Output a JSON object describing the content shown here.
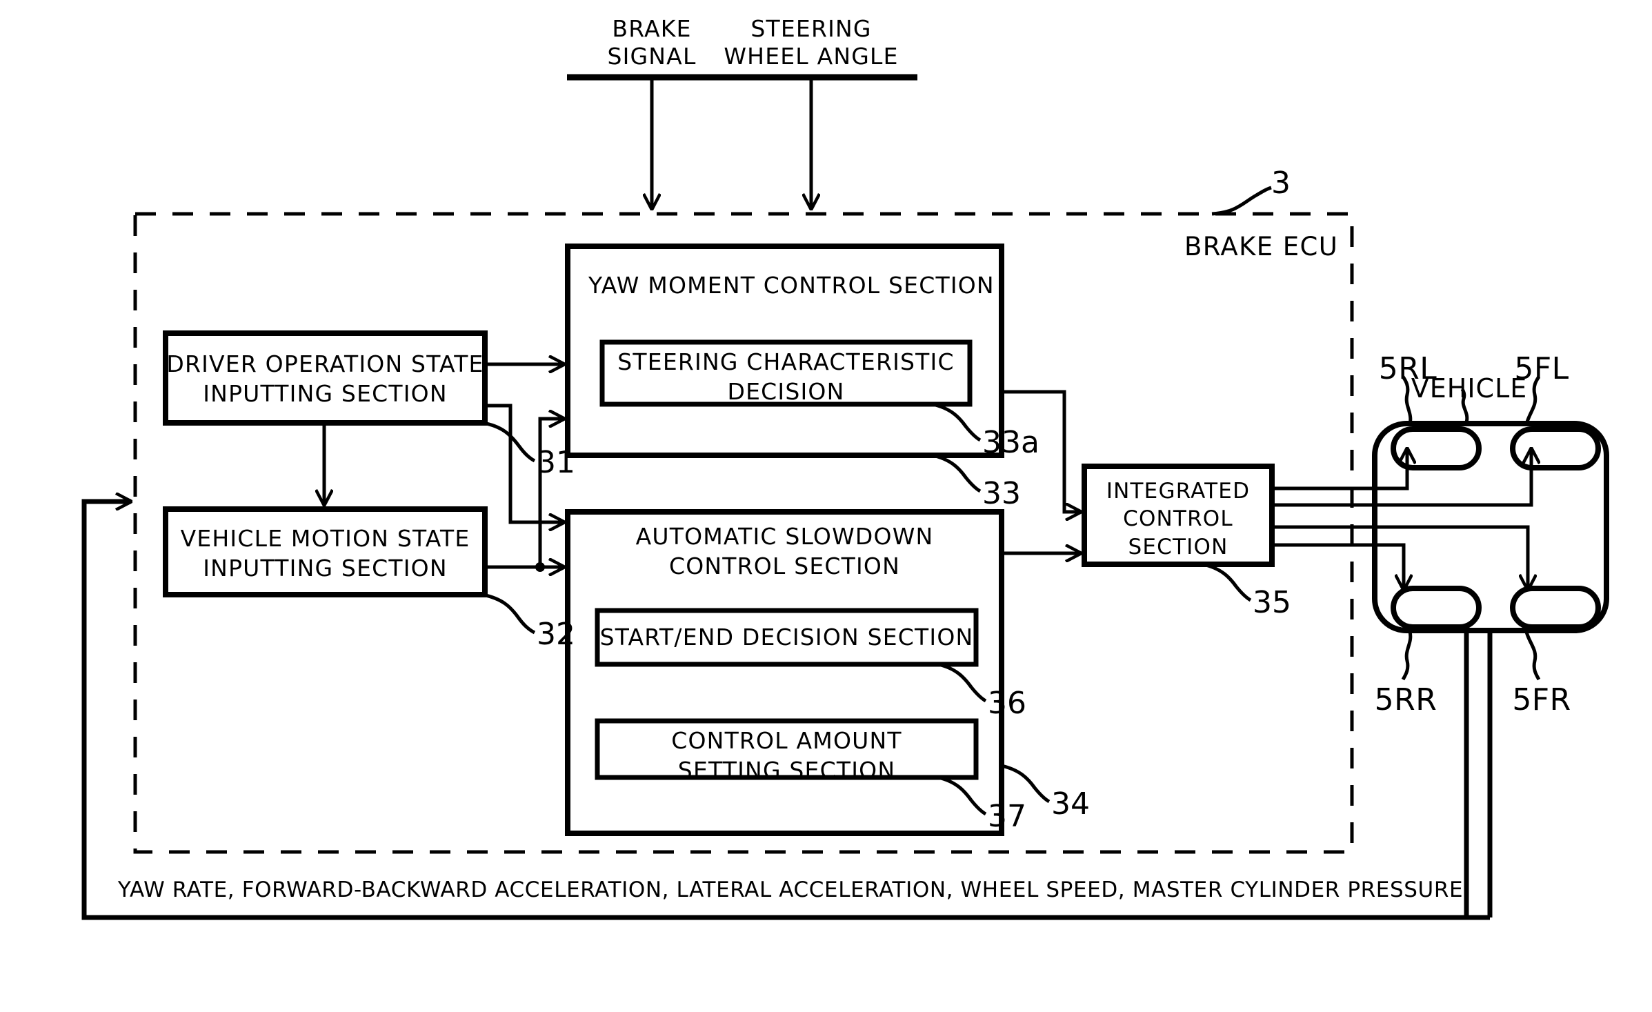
{
  "figure": {
    "kind": "patent-block-diagram",
    "inputs": [
      {
        "id": "brake-signal",
        "label": "BRAKE\nSIGNAL"
      },
      {
        "id": "steering-wheel-angle",
        "label": "STEERING\nWHEEL ANGLE"
      }
    ],
    "ecu": {
      "label": "BRAKE ECU",
      "ref": "3"
    },
    "blocks": [
      {
        "id": "driver-operation-state",
        "label": "DRIVER OPERATION STATE\nINPUTTING SECTION",
        "ref": "31"
      },
      {
        "id": "vehicle-motion-state",
        "label": "VEHICLE MOTION STATE\nINPUTTING SECTION",
        "ref": "32"
      },
      {
        "id": "yaw-moment-control",
        "label": "YAW MOMENT CONTROL SECTION",
        "ref": "33"
      },
      {
        "id": "steering-characteristic-decision",
        "label": "STEERING CHARACTERISTIC\nDECISION",
        "ref": "33a"
      },
      {
        "id": "automatic-slowdown-control",
        "label": "AUTOMATIC SLOWDOWN\nCONTROL SECTION",
        "ref": "34"
      },
      {
        "id": "start-end-decision",
        "label": "START/END DECISION SECTION",
        "ref": "36"
      },
      {
        "id": "control-amount-setting",
        "label": "CONTROL AMOUNT\nSETTING SECTION",
        "ref": "37"
      },
      {
        "id": "integrated-control",
        "label": "INTEGRATED\nCONTROL\nSECTION",
        "ref": "35"
      }
    ],
    "vehicle": {
      "label": "VEHICLE",
      "wheels": [
        {
          "id": "wheel-rear-left",
          "ref": "5RL"
        },
        {
          "id": "wheel-front-left",
          "ref": "5FL"
        },
        {
          "id": "wheel-rear-right",
          "ref": "5RR"
        },
        {
          "id": "wheel-front-right",
          "ref": "5FR"
        }
      ]
    },
    "feedback": {
      "label": "YAW RATE, FORWARD-BACKWARD ACCELERATION, LATERAL ACCELERATION, WHEEL SPEED, MASTER CYLINDER PRESSURE"
    },
    "colors": {
      "ink": "#000000",
      "paper": "#ffffff"
    }
  }
}
